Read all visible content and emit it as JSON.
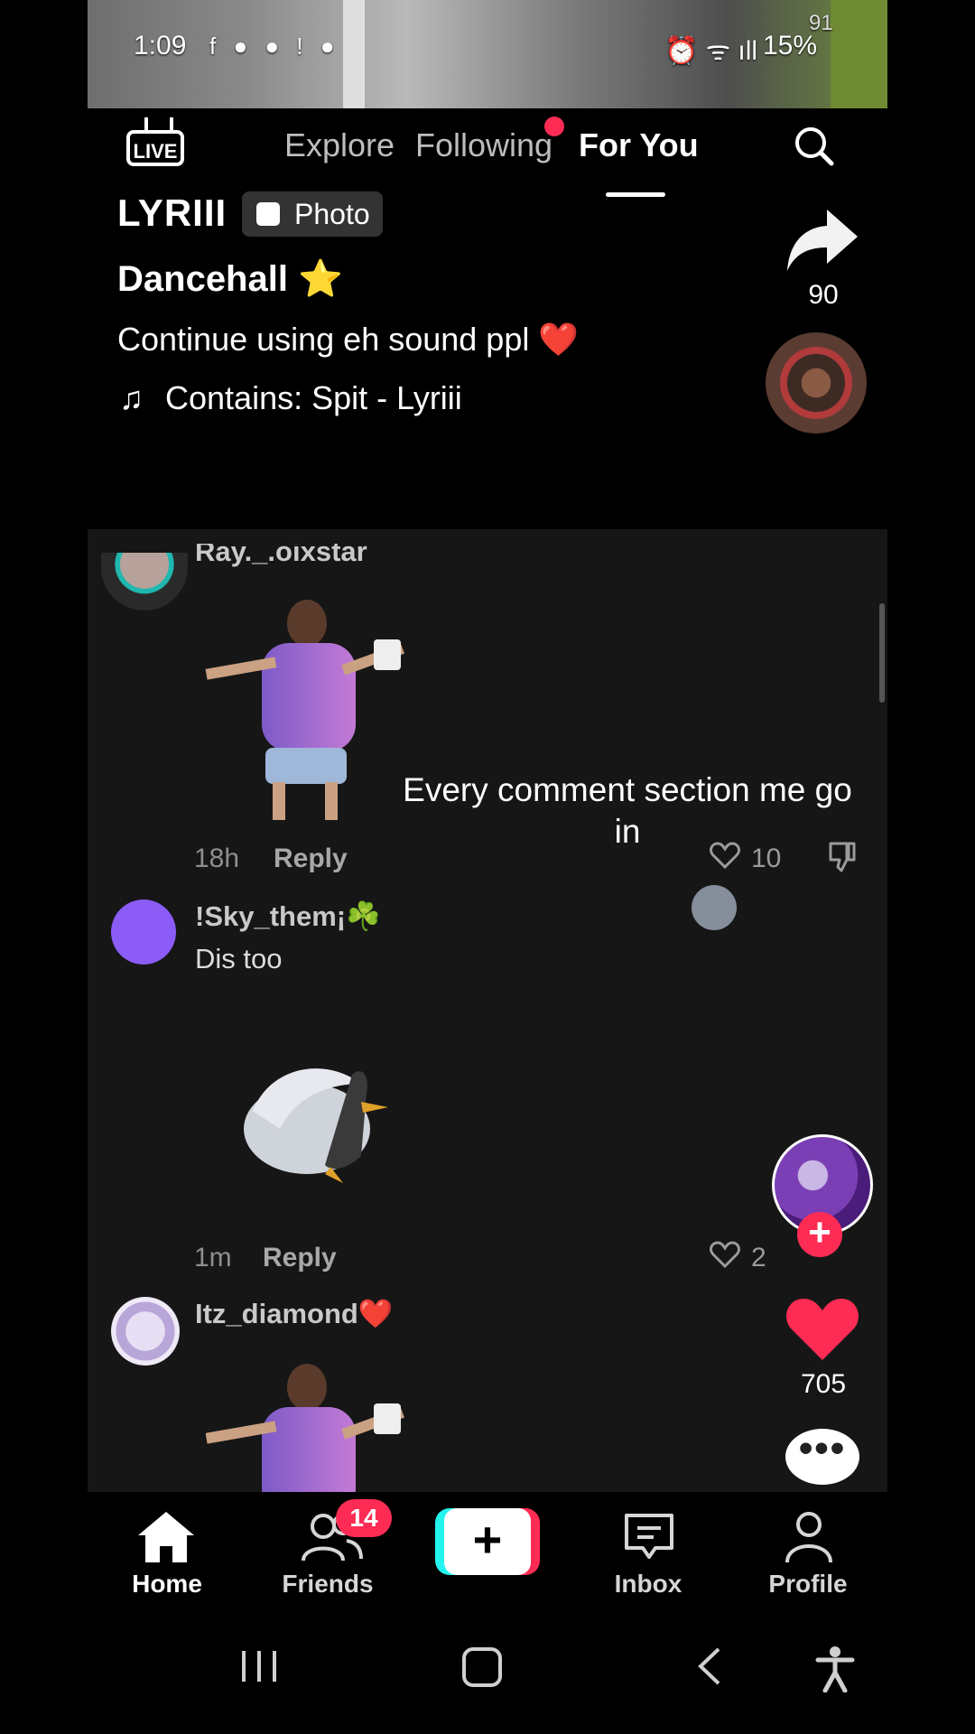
{
  "status_bar": {
    "time": "1:09",
    "battery": "15%",
    "notif_icons": "f ● ● ! ●",
    "corner_count": "91"
  },
  "top_nav": {
    "live_label": "LIVE",
    "tabs": [
      {
        "label": "Explore",
        "active": false
      },
      {
        "label": "Following",
        "active": false
      },
      {
        "label": "For You",
        "active": true
      }
    ]
  },
  "post": {
    "author": "LYRIII",
    "badge": "Photo",
    "title": "Dancehall ⭐",
    "caption": "Continue using eh sound ppl ❤️",
    "music": "Contains: Spit - Lyriii",
    "music_icon": "♫"
  },
  "right_rail": {
    "share_count": "90",
    "like_count": "705",
    "follow_symbol": "+",
    "more_symbol": "•••"
  },
  "comments": {
    "overlay_text": "Every comment section me go in",
    "items": [
      {
        "username": "Ray._.oixstar",
        "text": "",
        "time": "18h",
        "reply": "Reply",
        "likes": "10"
      },
      {
        "username": "!Sky_them¡☘️",
        "text": "Dis too",
        "time": "1m",
        "reply": "Reply",
        "likes": "2"
      },
      {
        "username": "Itz_diamond❤️",
        "text": "",
        "time": "",
        "reply": "",
        "likes": ""
      }
    ]
  },
  "bottom_nav": {
    "items": [
      {
        "label": "Home",
        "active": true
      },
      {
        "label": "Friends",
        "badge": "14"
      },
      {
        "label": "+"
      },
      {
        "label": "Inbox"
      },
      {
        "label": "Profile"
      }
    ]
  },
  "colors": {
    "accent": "#fe2c55",
    "cyan": "#25f4ee",
    "panel": "#161616"
  }
}
